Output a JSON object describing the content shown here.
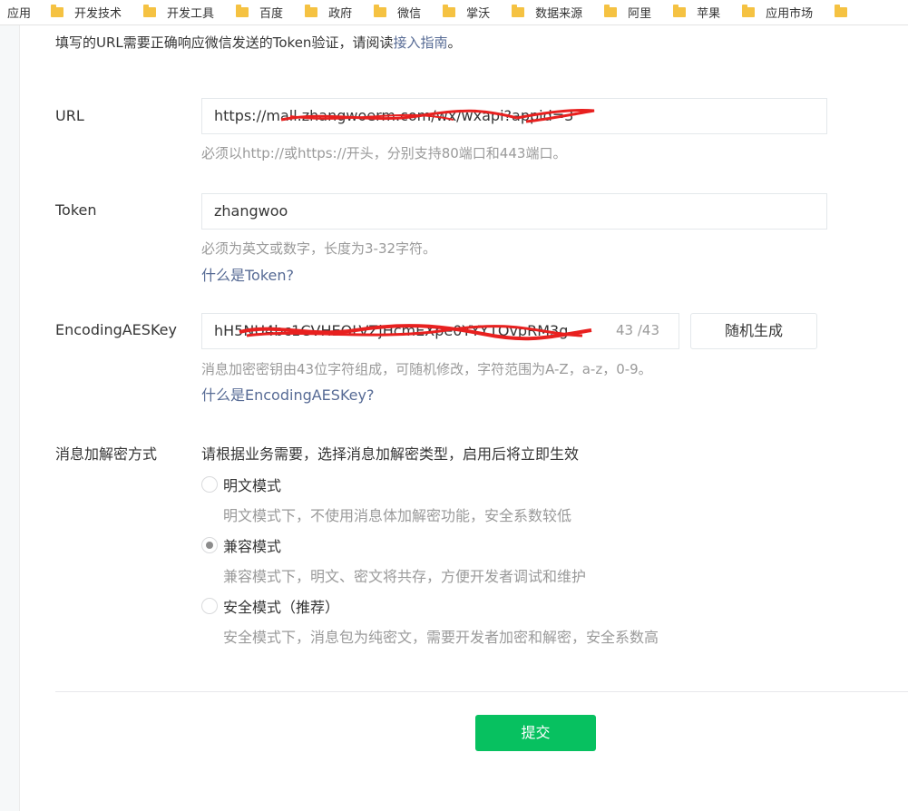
{
  "bookmarks": {
    "apps_label": "应用",
    "folders": [
      "开发技术",
      "开发工具",
      "百度",
      "政府",
      "微信",
      "掌沃",
      "数据来源",
      "阿里",
      "苹果",
      "应用市场"
    ]
  },
  "intro": {
    "text": "填写的URL需要正确响应微信发送的Token验证，请阅读",
    "link": "接入指南",
    "suffix": "。"
  },
  "url": {
    "label": "URL",
    "value": "https://mall.zhangwoerm.com/wx/wxapi?appid=3",
    "tip": "必须以http://或https://开头，分别支持80端口和443端口。"
  },
  "token": {
    "label": "Token",
    "value": "zhangwoo",
    "tip": "必须为英文或数字，长度为3-32字符。",
    "help_link": "什么是Token?"
  },
  "aes": {
    "label": "EncodingAESKey",
    "value": "hH5NU4bc1CVHEOLVZjHcmEXpe0YYY1OvpRM3g",
    "counter": "43 /43",
    "random_button": "随机生成",
    "tip": "消息加密密钥由43位字符组成，可随机修改，字符范围为A-Z，a-z，0-9。",
    "help_link": "什么是EncodingAESKey?"
  },
  "encrypt": {
    "label": "消息加解密方式",
    "description": "请根据业务需要，选择消息加解密类型，启用后将立即生效",
    "options": [
      {
        "label": "明文模式",
        "desc": "明文模式下，不使用消息体加解密功能，安全系数较低",
        "checked": false
      },
      {
        "label": "兼容模式",
        "desc": "兼容模式下，明文、密文将共存，方便开发者调试和维护",
        "checked": true
      },
      {
        "label": "安全模式（推荐）",
        "desc": "安全模式下，消息包为纯密文，需要开发者加密和解密，安全系数高",
        "checked": false
      }
    ]
  },
  "submit_label": "提交",
  "colors": {
    "primary": "#07c160",
    "link": "#576b95",
    "redaction": "#e8201f"
  }
}
